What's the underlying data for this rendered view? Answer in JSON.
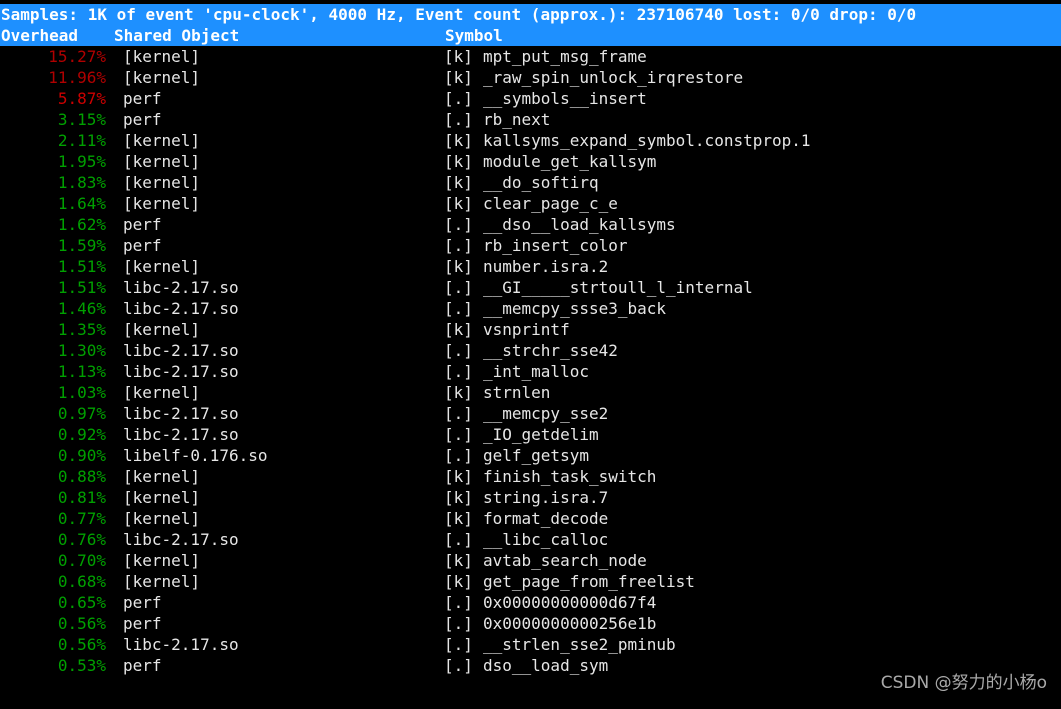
{
  "header": {
    "samples_line": "Samples: 1K of event 'cpu-clock', 4000 Hz, Event count (approx.): 237106740 lost: 0/0 drop: 0/0",
    "col_overhead": "Overhead",
    "col_shared_object": "Shared Object",
    "col_symbol": "Symbol",
    "bg_color": "#1e90ff",
    "fg_color": "#ffffff"
  },
  "colors": {
    "background": "#000000",
    "text": "#e6e6e6",
    "pct_hot": "#b00000",
    "pct_warm": "#cc0000",
    "pct_cool": "#00a000"
  },
  "rows": [
    {
      "overhead": "15.27%",
      "dso": "[kernel]",
      "marker": "[k]",
      "symbol": "mpt_put_msg_frame",
      "heat": "hot"
    },
    {
      "overhead": "11.96%",
      "dso": "[kernel]",
      "marker": "[k]",
      "symbol": "_raw_spin_unlock_irqrestore",
      "heat": "hot"
    },
    {
      "overhead": "5.87%",
      "dso": "perf",
      "marker": "[.]",
      "symbol": "__symbols__insert",
      "heat": "warm"
    },
    {
      "overhead": "3.15%",
      "dso": "perf",
      "marker": "[.]",
      "symbol": "rb_next",
      "heat": "cool"
    },
    {
      "overhead": "2.11%",
      "dso": "[kernel]",
      "marker": "[k]",
      "symbol": "kallsyms_expand_symbol.constprop.1",
      "heat": "cool"
    },
    {
      "overhead": "1.95%",
      "dso": "[kernel]",
      "marker": "[k]",
      "symbol": "module_get_kallsym",
      "heat": "cool"
    },
    {
      "overhead": "1.83%",
      "dso": "[kernel]",
      "marker": "[k]",
      "symbol": "__do_softirq",
      "heat": "cool"
    },
    {
      "overhead": "1.64%",
      "dso": "[kernel]",
      "marker": "[k]",
      "symbol": "clear_page_c_e",
      "heat": "cool"
    },
    {
      "overhead": "1.62%",
      "dso": "perf",
      "marker": "[.]",
      "symbol": "__dso__load_kallsyms",
      "heat": "cool"
    },
    {
      "overhead": "1.59%",
      "dso": "perf",
      "marker": "[.]",
      "symbol": "rb_insert_color",
      "heat": "cool"
    },
    {
      "overhead": "1.51%",
      "dso": "[kernel]",
      "marker": "[k]",
      "symbol": "number.isra.2",
      "heat": "cool"
    },
    {
      "overhead": "1.51%",
      "dso": "libc-2.17.so",
      "marker": "[.]",
      "symbol": "__GI_____strtoull_l_internal",
      "heat": "cool"
    },
    {
      "overhead": "1.46%",
      "dso": "libc-2.17.so",
      "marker": "[.]",
      "symbol": "__memcpy_ssse3_back",
      "heat": "cool"
    },
    {
      "overhead": "1.35%",
      "dso": "[kernel]",
      "marker": "[k]",
      "symbol": "vsnprintf",
      "heat": "cool"
    },
    {
      "overhead": "1.30%",
      "dso": "libc-2.17.so",
      "marker": "[.]",
      "symbol": "__strchr_sse42",
      "heat": "cool"
    },
    {
      "overhead": "1.13%",
      "dso": "libc-2.17.so",
      "marker": "[.]",
      "symbol": "_int_malloc",
      "heat": "cool"
    },
    {
      "overhead": "1.03%",
      "dso": "[kernel]",
      "marker": "[k]",
      "symbol": "strnlen",
      "heat": "cool"
    },
    {
      "overhead": "0.97%",
      "dso": "libc-2.17.so",
      "marker": "[.]",
      "symbol": "__memcpy_sse2",
      "heat": "cool"
    },
    {
      "overhead": "0.92%",
      "dso": "libc-2.17.so",
      "marker": "[.]",
      "symbol": "_IO_getdelim",
      "heat": "cool"
    },
    {
      "overhead": "0.90%",
      "dso": "libelf-0.176.so",
      "marker": "[.]",
      "symbol": "gelf_getsym",
      "heat": "cool"
    },
    {
      "overhead": "0.88%",
      "dso": "[kernel]",
      "marker": "[k]",
      "symbol": "finish_task_switch",
      "heat": "cool"
    },
    {
      "overhead": "0.81%",
      "dso": "[kernel]",
      "marker": "[k]",
      "symbol": "string.isra.7",
      "heat": "cool"
    },
    {
      "overhead": "0.77%",
      "dso": "[kernel]",
      "marker": "[k]",
      "symbol": "format_decode",
      "heat": "cool"
    },
    {
      "overhead": "0.76%",
      "dso": "libc-2.17.so",
      "marker": "[.]",
      "symbol": "__libc_calloc",
      "heat": "cool"
    },
    {
      "overhead": "0.70%",
      "dso": "[kernel]",
      "marker": "[k]",
      "symbol": "avtab_search_node",
      "heat": "cool"
    },
    {
      "overhead": "0.68%",
      "dso": "[kernel]",
      "marker": "[k]",
      "symbol": "get_page_from_freelist",
      "heat": "cool"
    },
    {
      "overhead": "0.65%",
      "dso": "perf",
      "marker": "[.]",
      "symbol": "0x00000000000d67f4",
      "heat": "cool"
    },
    {
      "overhead": "0.56%",
      "dso": "perf",
      "marker": "[.]",
      "symbol": "0x0000000000256e1b",
      "heat": "cool"
    },
    {
      "overhead": "0.56%",
      "dso": "libc-2.17.so",
      "marker": "[.]",
      "symbol": "__strlen_sse2_pminub",
      "heat": "cool"
    },
    {
      "overhead": "0.53%",
      "dso": "perf",
      "marker": "[.]",
      "symbol": "dso__load_sym",
      "heat": "cool"
    }
  ],
  "watermark": {
    "text": "CSDN @努力的小杨o"
  }
}
